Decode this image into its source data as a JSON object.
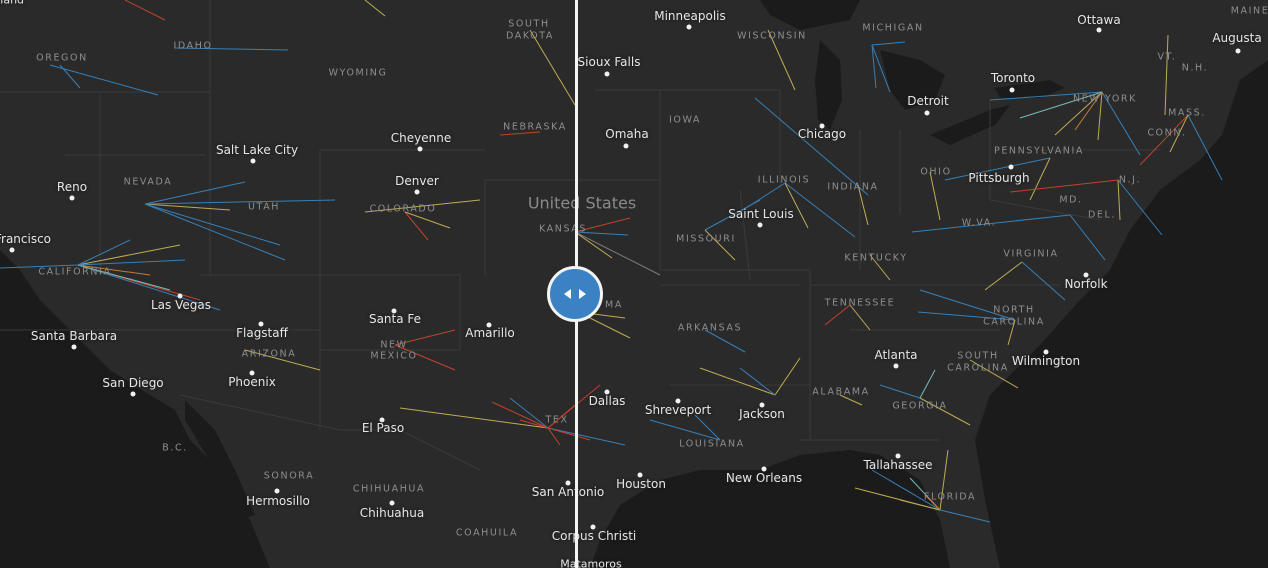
{
  "country_label": "United States",
  "cities": [
    {
      "id": "minneapolis",
      "name": "Minneapolis"
    },
    {
      "id": "ottawa",
      "name": "Ottawa"
    },
    {
      "id": "augusta",
      "name": "Augusta"
    },
    {
      "id": "sioux-falls",
      "name": "Sioux Falls"
    },
    {
      "id": "toronto",
      "name": "Toronto"
    },
    {
      "id": "detroit",
      "name": "Detroit"
    },
    {
      "id": "omaha",
      "name": "Omaha"
    },
    {
      "id": "chicago",
      "name": "Chicago"
    },
    {
      "id": "cheyenne",
      "name": "Cheyenne"
    },
    {
      "id": "salt-lake-city",
      "name": "Salt Lake City"
    },
    {
      "id": "pittsburgh",
      "name": "Pittsburgh"
    },
    {
      "id": "reno",
      "name": "Reno"
    },
    {
      "id": "denver",
      "name": "Denver"
    },
    {
      "id": "saint-louis",
      "name": "Saint Louis"
    },
    {
      "id": "san-francisco",
      "name": "Francisco"
    },
    {
      "id": "las-vegas",
      "name": "Las Vegas"
    },
    {
      "id": "norfolk",
      "name": "Norfolk"
    },
    {
      "id": "santa-fe",
      "name": "Santa Fe"
    },
    {
      "id": "flagstaff",
      "name": "Flagstaff"
    },
    {
      "id": "amarillo",
      "name": "Amarillo"
    },
    {
      "id": "santa-barbara",
      "name": "Santa Barbara"
    },
    {
      "id": "atlanta",
      "name": "Atlanta"
    },
    {
      "id": "wilmington",
      "name": "Wilmington"
    },
    {
      "id": "phoenix",
      "name": "Phoenix"
    },
    {
      "id": "san-diego",
      "name": "San Diego"
    },
    {
      "id": "dallas",
      "name": "Dallas"
    },
    {
      "id": "shreveport",
      "name": "Shreveport"
    },
    {
      "id": "jackson",
      "name": "Jackson"
    },
    {
      "id": "el-paso",
      "name": "El Paso"
    },
    {
      "id": "tallahassee",
      "name": "Tallahassee"
    },
    {
      "id": "new-orleans",
      "name": "New Orleans"
    },
    {
      "id": "houston",
      "name": "Houston"
    },
    {
      "id": "san-antonio",
      "name": "San Antonio"
    },
    {
      "id": "hermosillo",
      "name": "Hermosillo"
    },
    {
      "id": "chihuahua",
      "name": "Chihuahua"
    },
    {
      "id": "corpus-christi",
      "name": "Corpus Christi"
    },
    {
      "id": "matamoros",
      "name": "Matamoros"
    },
    {
      "id": "portland-partial",
      "name": "tland"
    }
  ],
  "states": [
    {
      "id": "oregon",
      "name": "OREGON"
    },
    {
      "id": "idaho",
      "name": "IDAHO"
    },
    {
      "id": "wyoming",
      "name": "WYOMING"
    },
    {
      "id": "south-dakota-1",
      "name": "SOUTH"
    },
    {
      "id": "south-dakota-2",
      "name": "DAKOTA"
    },
    {
      "id": "nebraska",
      "name": "NEBRASKA"
    },
    {
      "id": "wisconsin",
      "name": "WISCONSIN"
    },
    {
      "id": "michigan",
      "name": "MICHIGAN"
    },
    {
      "id": "vt",
      "name": "VT."
    },
    {
      "id": "nh",
      "name": "N.H."
    },
    {
      "id": "maine",
      "name": "MAINE"
    },
    {
      "id": "new-york",
      "name": "NEW YORK"
    },
    {
      "id": "mass",
      "name": "MASS."
    },
    {
      "id": "conn",
      "name": "CONN."
    },
    {
      "id": "iowa",
      "name": "IOWA"
    },
    {
      "id": "pennsylvania",
      "name": "PENNSYLVANIA"
    },
    {
      "id": "nevada",
      "name": "NEVADA"
    },
    {
      "id": "utah",
      "name": "UTAH"
    },
    {
      "id": "colorado",
      "name": "COLORADO"
    },
    {
      "id": "illinois",
      "name": "ILLINOIS"
    },
    {
      "id": "indiana",
      "name": "INDIANA"
    },
    {
      "id": "ohio",
      "name": "OHIO"
    },
    {
      "id": "nj",
      "name": "N.J."
    },
    {
      "id": "md",
      "name": "MD."
    },
    {
      "id": "del",
      "name": "DEL."
    },
    {
      "id": "california",
      "name": "CALIFORNIA"
    },
    {
      "id": "kansas",
      "name": "KANSAS"
    },
    {
      "id": "missouri",
      "name": "MISSOURI"
    },
    {
      "id": "wva",
      "name": "W.VA."
    },
    {
      "id": "virginia",
      "name": "VIRGINIA"
    },
    {
      "id": "kentucky",
      "name": "KENTUCKY"
    },
    {
      "id": "oklahoma-partial",
      "name": "MA"
    },
    {
      "id": "tennessee",
      "name": "TENNESSEE"
    },
    {
      "id": "north-carolina-1",
      "name": "NORTH"
    },
    {
      "id": "north-carolina-2",
      "name": "CAROLINA"
    },
    {
      "id": "arizona",
      "name": "ARIZONA"
    },
    {
      "id": "new-mexico-1",
      "name": "NEW"
    },
    {
      "id": "new-mexico-2",
      "name": "MEXICO"
    },
    {
      "id": "arkansas",
      "name": "ARKANSAS"
    },
    {
      "id": "south-carolina-1",
      "name": "SOUTH"
    },
    {
      "id": "south-carolina-2",
      "name": "CAROLINA"
    },
    {
      "id": "alabama",
      "name": "ALABAMA"
    },
    {
      "id": "georgia",
      "name": "GEORGIA"
    },
    {
      "id": "texas-partial",
      "name": "TEX"
    },
    {
      "id": "louisiana",
      "name": "LOUISIANA"
    },
    {
      "id": "bc",
      "name": "B.C."
    },
    {
      "id": "sonora",
      "name": "SONORA"
    },
    {
      "id": "chihuahua-state",
      "name": "CHIHUAHUA"
    },
    {
      "id": "coahuila",
      "name": "COAHUILA"
    },
    {
      "id": "florida",
      "name": "FLORIDA"
    }
  ],
  "colors": {
    "land": "#2a2a2a",
    "water": "#1b1b1b",
    "border": "#3a3a3a",
    "divider": "#f4f4f4",
    "handle": "#3b82c4",
    "flow_blue": "#3a8fd0",
    "flow_yellow": "#d8c25a",
    "flow_red": "#e0452f",
    "flow_cyan": "#7fd6d0",
    "flow_orange": "#e08a3a"
  },
  "compare_slider": {
    "icons": [
      "chevron-left-icon",
      "chevron-right-icon"
    ]
  }
}
